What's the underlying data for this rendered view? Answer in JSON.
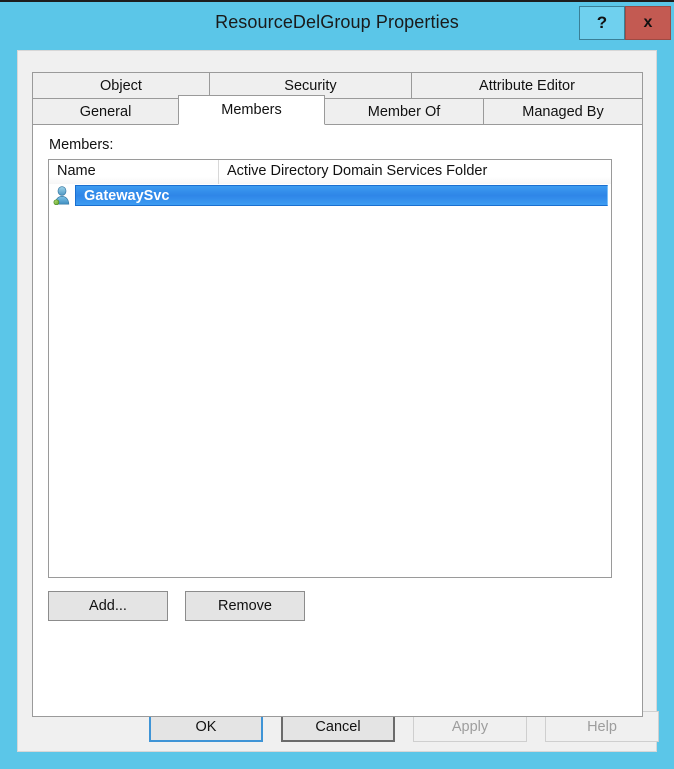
{
  "window": {
    "title": "ResourceDelGroup Properties",
    "frame_color": "#5BC6E8",
    "caption_buttons": [
      {
        "name": "help-button",
        "glyph": "?",
        "color": "#6FD0EE"
      },
      {
        "name": "close-button",
        "glyph": "x",
        "color": "#C35A52"
      }
    ]
  },
  "tabs": {
    "top_row": [
      {
        "label": "Object",
        "active": false
      },
      {
        "label": "Security",
        "active": false
      },
      {
        "label": "Attribute Editor",
        "active": false
      }
    ],
    "bottom_row": [
      {
        "label": "General",
        "active": false
      },
      {
        "label": "Members",
        "active": true
      },
      {
        "label": "Member Of",
        "active": false
      },
      {
        "label": "Managed By",
        "active": false
      }
    ],
    "selected": "Members"
  },
  "panel": {
    "members_label": "Members:",
    "listview": {
      "columns": [
        {
          "key": "name",
          "header": "Name"
        },
        {
          "key": "folder",
          "header": "Active Directory Domain Services Folder"
        }
      ],
      "rows": [
        {
          "name": "GatewaySvc",
          "folder": "",
          "icon": "user-icon",
          "selected": true
        }
      ],
      "selection_color": "#2F86E8"
    },
    "buttons": [
      {
        "name": "add-button",
        "label": "Add...",
        "enabled": true
      },
      {
        "name": "remove-button",
        "label": "Remove",
        "enabled": true
      }
    ]
  },
  "dialog_buttons": [
    {
      "name": "ok-button",
      "label": "OK",
      "enabled": true,
      "state": "default"
    },
    {
      "name": "cancel-button",
      "label": "Cancel",
      "enabled": true,
      "state": "focused"
    },
    {
      "name": "apply-button",
      "label": "Apply",
      "enabled": false,
      "state": "disabled"
    },
    {
      "name": "help-button",
      "label": "Help",
      "enabled": false,
      "state": "disabled"
    }
  ]
}
